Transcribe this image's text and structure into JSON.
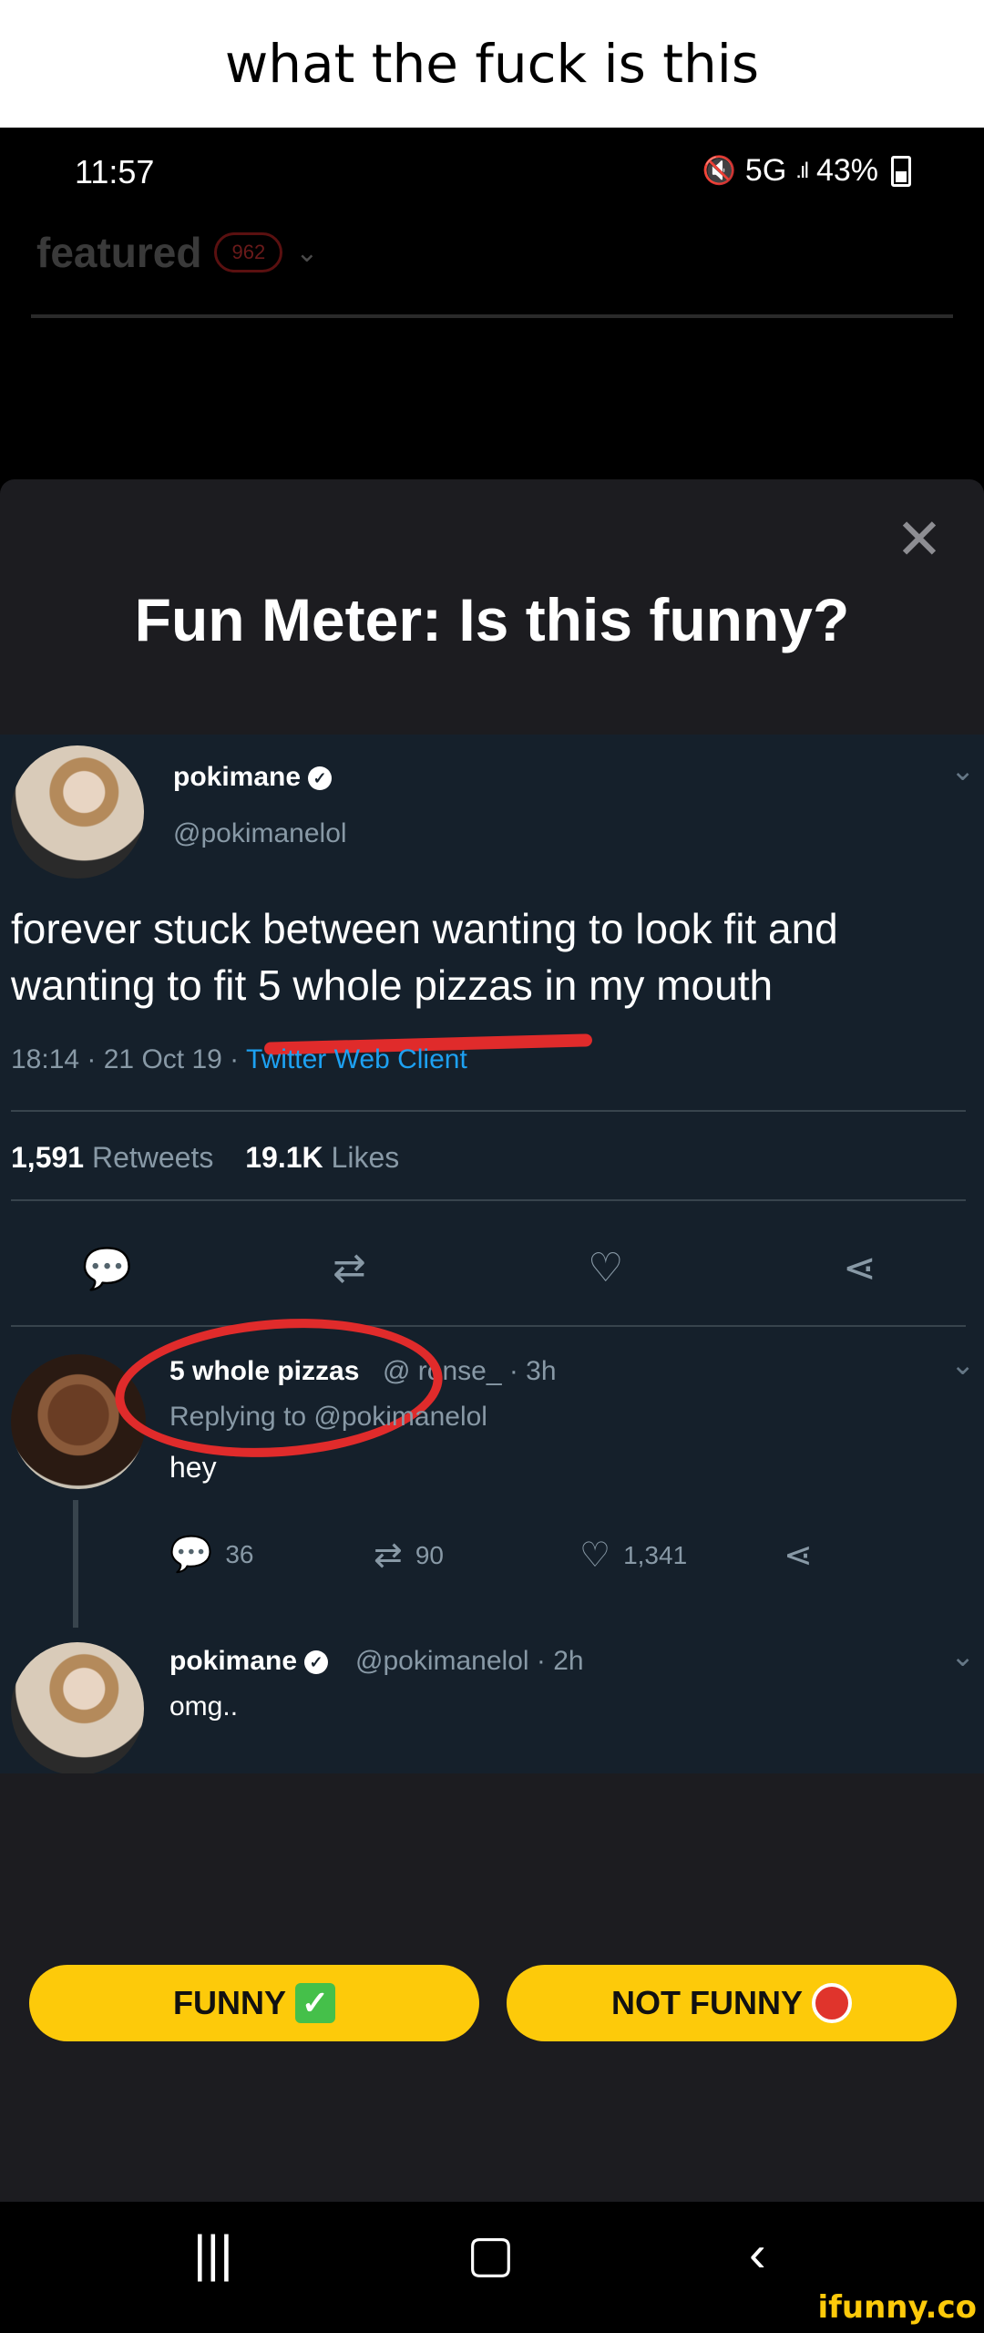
{
  "caption": {
    "text": "what the fuck is this"
  },
  "status_bar": {
    "time": "11:57",
    "network": "5G",
    "battery": "43%"
  },
  "feed": {
    "section": "featured",
    "count": "962"
  },
  "modal": {
    "title": "Fun Meter: Is this funny?",
    "buttons": {
      "funny": "FUNNY",
      "not_funny": "NOT FUNNY"
    }
  },
  "tweet": {
    "name": "pokimane",
    "handle": "@pokimanelol",
    "text_line1": "forever stuck between wanting to look fit and",
    "text_line2": "wanting to fit 5 whole pizzas in my mouth",
    "meta": "18:14 · 21 Oct 19 · ",
    "client": "Twitter Web Client",
    "retweets_count": "1,591",
    "retweets_label": "Retweets",
    "likes_count": "19.1K",
    "likes_label": "Likes"
  },
  "reply1": {
    "name": "5 whole pizzas",
    "handle_time": "@  ronse_ · 3h",
    "replying": "Replying to @pokimanelol",
    "text": "hey",
    "replies": "36",
    "retweets": "90",
    "likes": "1,341"
  },
  "reply2": {
    "name": "pokimane",
    "handle_time": "@pokimanelol · 2h",
    "text": "omg.."
  },
  "watermark": "ifunny.co"
}
